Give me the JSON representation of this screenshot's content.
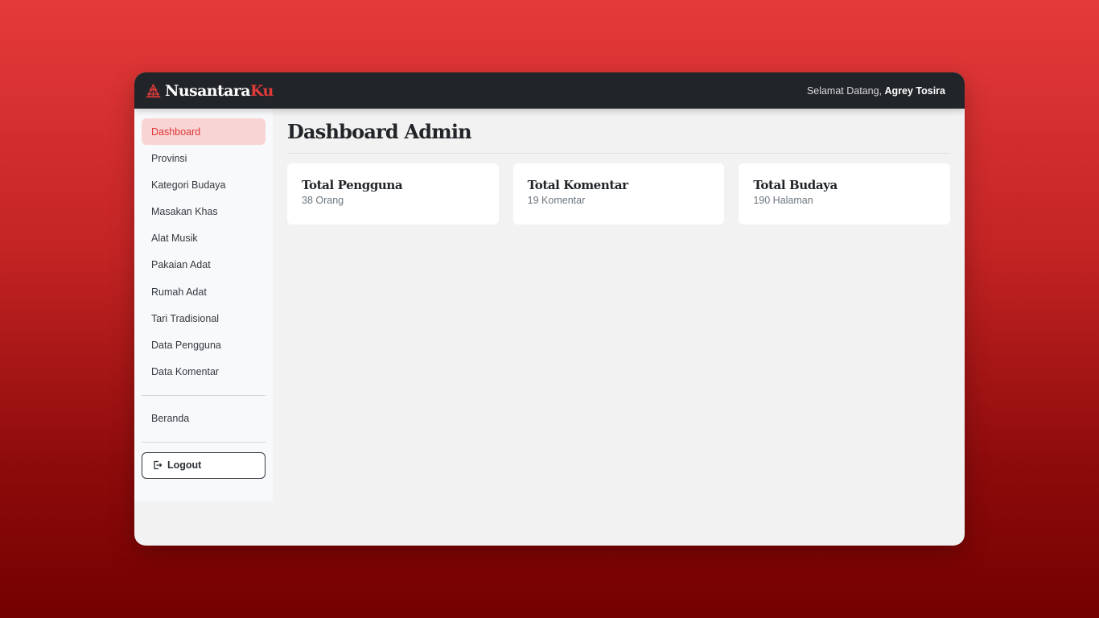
{
  "brand": {
    "part1": "Nusantara",
    "part2": "Ku",
    "icon": "temple-icon",
    "accent": "#e03a3a"
  },
  "header": {
    "greeting_prefix": "Selamat Datang,",
    "user_name": "Agrey Tosira"
  },
  "sidebar": {
    "items": [
      {
        "label": "Dashboard",
        "active": true
      },
      {
        "label": "Provinsi"
      },
      {
        "label": "Kategori Budaya"
      },
      {
        "label": "Masakan Khas"
      },
      {
        "label": "Alat Musik"
      },
      {
        "label": "Pakaian Adat"
      },
      {
        "label": "Rumah Adat"
      },
      {
        "label": "Tari Tradisional"
      },
      {
        "label": "Data Pengguna"
      },
      {
        "label": "Data Komentar"
      }
    ],
    "secondary": {
      "label": "Beranda"
    },
    "logout": {
      "label": "Logout",
      "icon": "logout-icon"
    }
  },
  "main": {
    "title": "Dashboard Admin",
    "cards": [
      {
        "title": "Total Pengguna",
        "value": "38 Orang"
      },
      {
        "title": "Total Komentar",
        "value": "19 Komentar"
      },
      {
        "title": "Total Budaya",
        "value": "190 Halaman"
      }
    ]
  }
}
